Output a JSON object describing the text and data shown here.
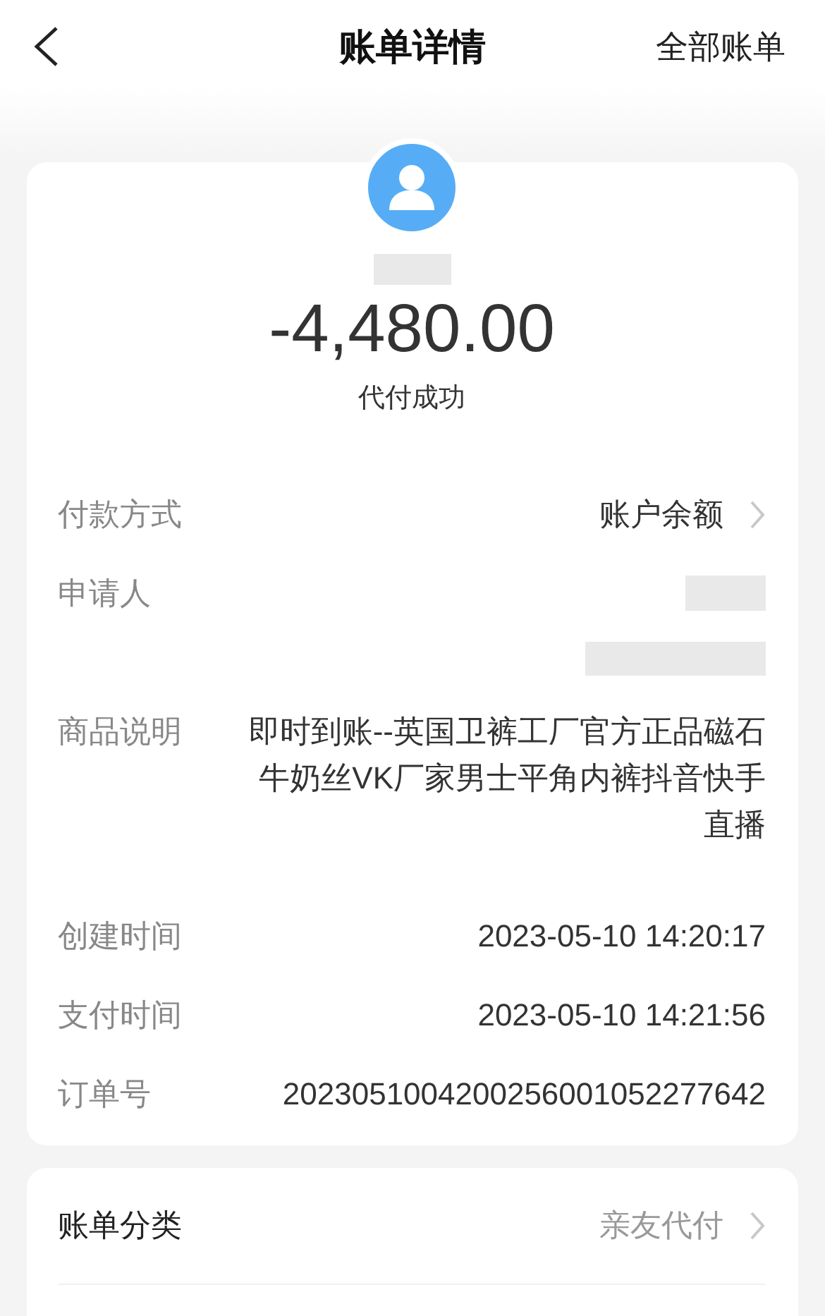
{
  "header": {
    "title": "账单详情",
    "action": "全部账单"
  },
  "summary": {
    "amount": "-4,480.00",
    "status": "代付成功"
  },
  "details": [
    {
      "kind": "link",
      "label": "付款方式",
      "value": "账户余额"
    },
    {
      "kind": "redacted",
      "label": "申请人"
    },
    {
      "kind": "text",
      "label": "商品说明",
      "value": "即时到账--英国卫裤工厂官方正品磁石牛奶丝VK厂家男士平角内裤抖音快手直播"
    },
    {
      "kind": "text",
      "label": "创建时间",
      "value": "2023-05-10 14:20:17"
    },
    {
      "kind": "text",
      "label": "支付时间",
      "value": "2023-05-10 14:21:56"
    },
    {
      "kind": "text",
      "label": "订单号",
      "value": "2023051004200256001052277642"
    }
  ],
  "category": {
    "label": "账单分类",
    "value": "亲友代付"
  }
}
